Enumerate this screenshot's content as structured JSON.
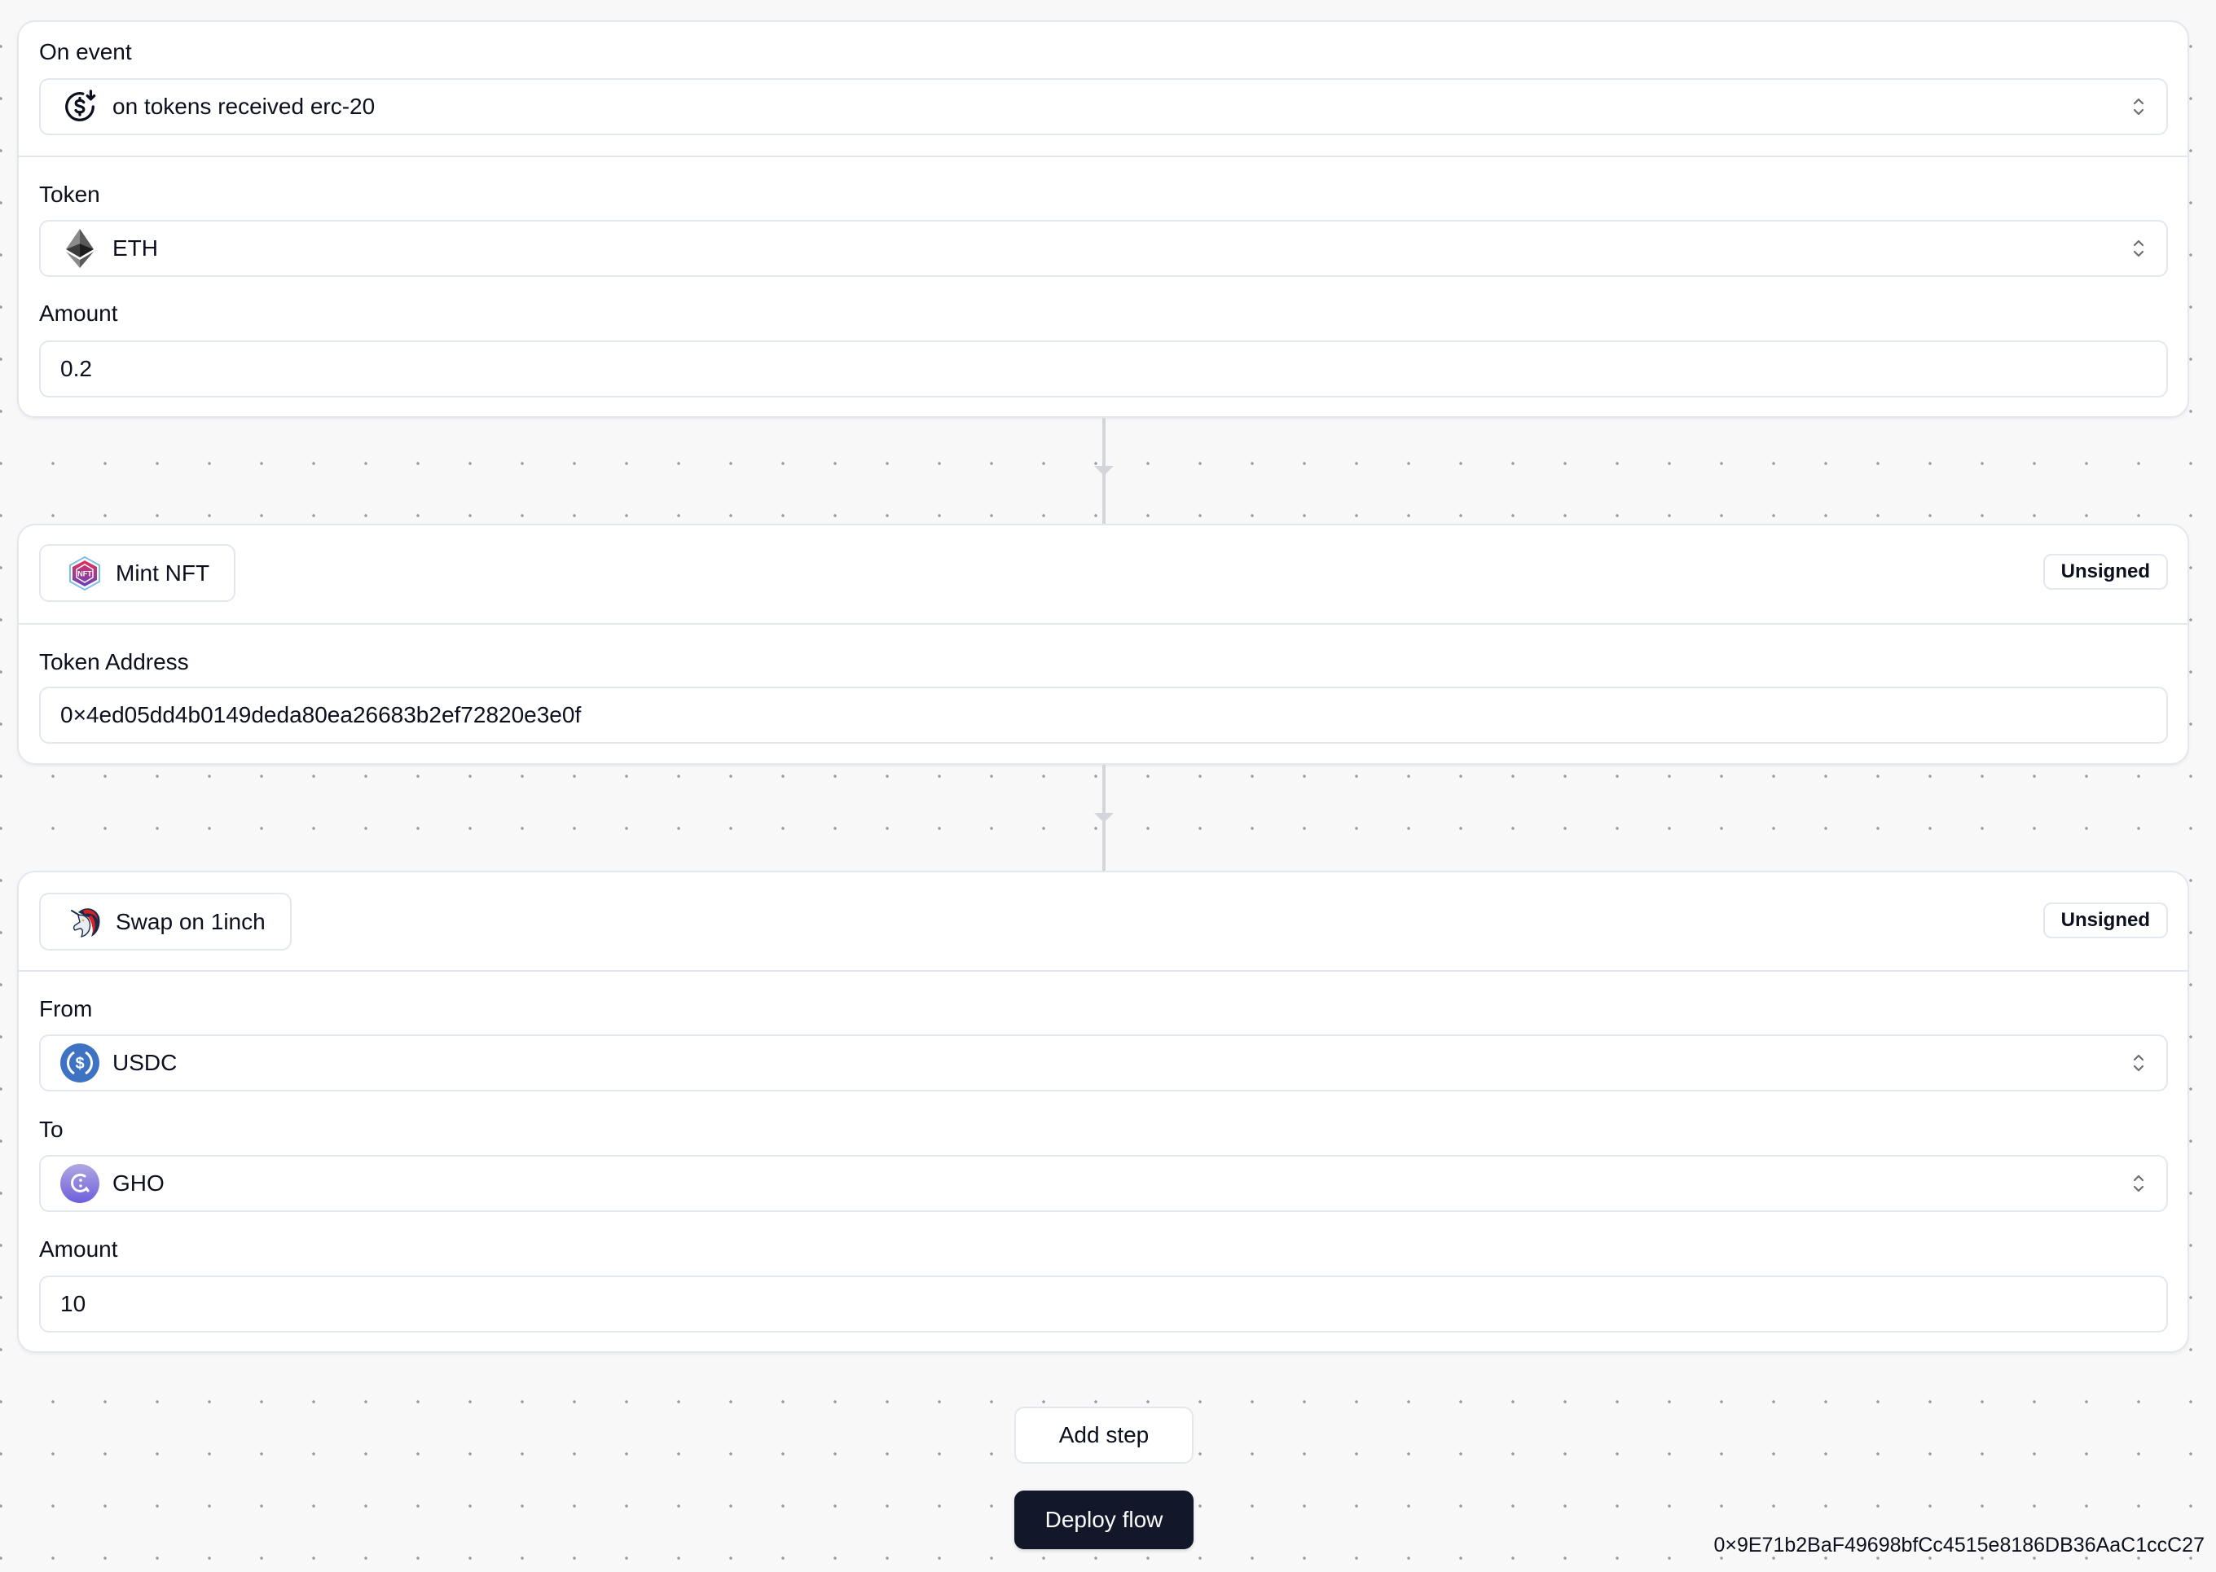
{
  "trigger_card": {
    "event_label": "On event",
    "event_value": "on tokens received erc-20",
    "event_icon": "dollar-receive-icon",
    "token_label": "Token",
    "token_value": "ETH",
    "token_icon": "ethereum-icon",
    "amount_label": "Amount",
    "amount_value": "0.2"
  },
  "steps": [
    {
      "title": "Mint NFT",
      "icon": "nft-icon",
      "status": "Unsigned",
      "fields": {
        "token_address_label": "Token Address",
        "token_address_value": "0×4ed05dd4b0149deda80ea26683b2ef72820e3e0f"
      }
    },
    {
      "title": "Swap on 1inch",
      "icon": "1inch-unicorn-icon",
      "status": "Unsigned",
      "fields": {
        "from_label": "From",
        "from_value": "USDC",
        "from_icon": "usdc-icon",
        "to_label": "To",
        "to_value": "GHO",
        "to_icon": "gho-icon",
        "amount_label": "Amount",
        "amount_value": "10"
      }
    }
  ],
  "actions": {
    "add_step": "Add step",
    "deploy_flow": "Deploy flow"
  },
  "wallet_address": "0×9E71b2BaF49698bfCc4515e8186DB36AaC1ccC27",
  "colors": {
    "primary_button": "#121829",
    "border": "#e3e7ee",
    "connector": "#d4d5db",
    "usdc": "#3e73c4",
    "gho": "#8b7ee0"
  }
}
